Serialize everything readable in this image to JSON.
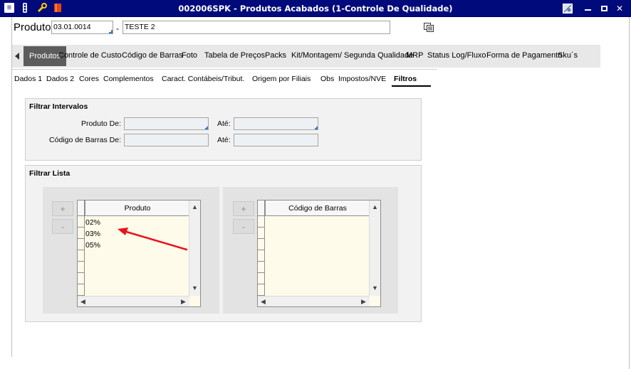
{
  "window": {
    "title": "002006SPK - Produtos Acabados (1-Controle De Qualidade)"
  },
  "header": {
    "produto_label": "Produto",
    "code_value": "03.01.0014",
    "separator": "-",
    "description_value": "TESTE 2"
  },
  "nav": {
    "items": [
      "Produtos",
      "Controle de Custo",
      "Código de Barras",
      "Foto",
      "Tabela de Preços",
      "Packs",
      "Kit/Montagem/ Segunda Qualidade",
      "MRP",
      "Status Log/Fluxo",
      "Forma de Pagamento",
      "Sku´s"
    ],
    "active": "Produtos"
  },
  "subtabs": {
    "items": [
      "Dados 1",
      "Dados 2",
      "Cores",
      "Complementos",
      "Caract. Contábeis/Tribut.",
      "Origem por Filiais",
      "Obs",
      "Impostos/NVE",
      "Filtros"
    ],
    "active": "Filtros"
  },
  "filtrar_intervalos": {
    "title": "Filtrar Intervalos",
    "produto_de_label": "Produto De:",
    "codigo_barras_de_label": "Código de Barras De:",
    "ate_label": "Até:"
  },
  "filtrar_lista": {
    "title": "Filtrar Lista",
    "add_label": "+",
    "remove_label": "-",
    "produto_grid": {
      "header": "Produto",
      "rows": [
        "02%",
        "03%",
        "05%"
      ]
    },
    "codigo_barras_grid": {
      "header": "Código de Barras",
      "rows": []
    }
  },
  "colors": {
    "titlebar": "#000a7a",
    "nav_active_bg": "#5c5c5c",
    "grid_bg": "#fffbea",
    "annotation_arrow": "#e8141b"
  }
}
